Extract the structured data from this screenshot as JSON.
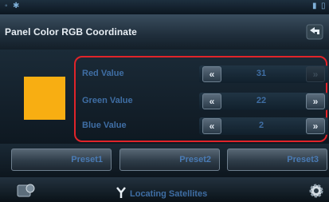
{
  "header": {
    "title": "Panel Color RGB Coordinate"
  },
  "swatch": {
    "color": "#f8ae12"
  },
  "rgb": {
    "rows": [
      {
        "label": "Red Value",
        "value": "31",
        "decrement": "«",
        "increment": "»"
      },
      {
        "label": "Green Value",
        "value": "22",
        "decrement": "«",
        "increment": "»"
      },
      {
        "label": "Blue Value",
        "value": "2",
        "decrement": "«",
        "increment": "»"
      }
    ]
  },
  "presets": [
    "Preset1",
    "Preset2",
    "Preset3"
  ],
  "footer": {
    "status": "Locating Satellites"
  },
  "colors": {
    "accent_highlight": "#e0242a",
    "text_blue": "#3f6ea4"
  }
}
